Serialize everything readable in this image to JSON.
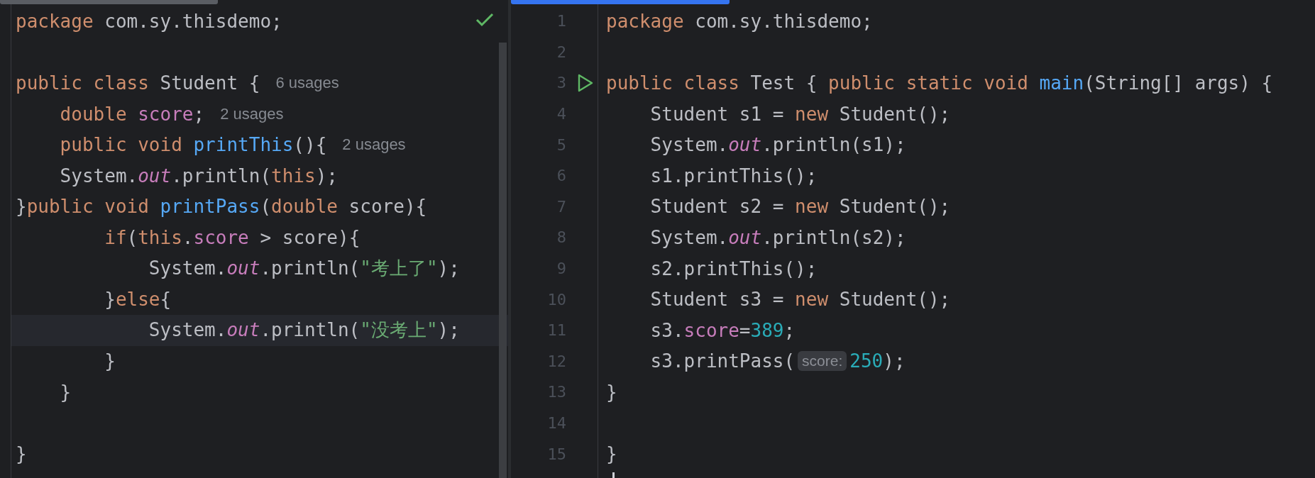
{
  "editors": [
    {
      "inspection_ok": true,
      "lines": [
        {
          "current": false,
          "tokens": [
            {
              "kind": "keyword",
              "text": "package"
            },
            {
              "kind": "plain",
              "text": " com.sy.thisdemo;"
            }
          ]
        },
        {
          "current": false
        },
        {
          "current": false,
          "usages": "6 usages",
          "tokens": [
            {
              "kind": "keyword",
              "text": "public class"
            },
            {
              "kind": "plain",
              "text": " Student {"
            }
          ]
        },
        {
          "current": false,
          "usages": "2 usages",
          "tokens": [
            {
              "kind": "keyword",
              "text": "    double"
            },
            {
              "kind": "field",
              "text": " score"
            },
            {
              "kind": "plain",
              "text": ";"
            }
          ]
        },
        {
          "current": false,
          "usages": "2 usages",
          "tokens": [
            {
              "kind": "keyword",
              "text": "    public void"
            },
            {
              "kind": "method",
              "text": " printThis"
            },
            {
              "kind": "plain",
              "text": "(){"
            }
          ]
        },
        {
          "current": false,
          "tokens": [
            {
              "kind": "plain",
              "text": "    System."
            },
            {
              "kind": "static_field",
              "text": "out"
            },
            {
              "kind": "plain",
              "text": ".println("
            },
            {
              "kind": "keyword",
              "text": "this"
            },
            {
              "kind": "plain",
              "text": ");"
            }
          ]
        },
        {
          "current": false,
          "tokens": [
            {
              "kind": "plain",
              "text": "}"
            },
            {
              "kind": "keyword",
              "text": "public void"
            },
            {
              "kind": "method",
              "text": " printPass"
            },
            {
              "kind": "plain",
              "text": "("
            },
            {
              "kind": "keyword",
              "text": "double"
            },
            {
              "kind": "plain",
              "text": " score){"
            }
          ]
        },
        {
          "current": false,
          "tokens": [
            {
              "kind": "keyword",
              "text": "        if"
            },
            {
              "kind": "plain",
              "text": "("
            },
            {
              "kind": "keyword",
              "text": "this"
            },
            {
              "kind": "plain",
              "text": "."
            },
            {
              "kind": "field",
              "text": "score"
            },
            {
              "kind": "plain",
              "text": " > score){"
            }
          ]
        },
        {
          "current": false,
          "tokens": [
            {
              "kind": "plain",
              "text": "            System."
            },
            {
              "kind": "static_field",
              "text": "out"
            },
            {
              "kind": "plain",
              "text": ".println("
            },
            {
              "kind": "string",
              "text": "\"考上了\""
            },
            {
              "kind": "plain",
              "text": ");"
            }
          ]
        },
        {
          "current": false,
          "tokens": [
            {
              "kind": "plain",
              "text": "        }"
            },
            {
              "kind": "keyword",
              "text": "else"
            },
            {
              "kind": "plain",
              "text": "{"
            }
          ]
        },
        {
          "current": true,
          "tokens": [
            {
              "kind": "plain",
              "text": "            System."
            },
            {
              "kind": "static_field",
              "text": "out"
            },
            {
              "kind": "plain",
              "text": ".println("
            },
            {
              "kind": "string",
              "text": "\"没考上\""
            },
            {
              "kind": "plain",
              "text": ");"
            }
          ]
        },
        {
          "current": false,
          "tokens": [
            {
              "kind": "plain",
              "text": "        }"
            }
          ]
        },
        {
          "current": false,
          "tokens": [
            {
              "kind": "plain",
              "text": "    }"
            }
          ]
        },
        {
          "current": false
        },
        {
          "current": false,
          "tokens": [
            {
              "kind": "plain",
              "text": "}"
            }
          ]
        }
      ]
    },
    {
      "lines": [
        {
          "number": "1",
          "current": false,
          "tokens": [
            {
              "kind": "keyword",
              "text": "package"
            },
            {
              "kind": "plain",
              "text": " com.sy.thisdemo;"
            }
          ]
        },
        {
          "number": "2",
          "current": false
        },
        {
          "number": "3",
          "current": false,
          "run_icon": true,
          "tokens": [
            {
              "kind": "keyword",
              "text": "public class"
            },
            {
              "kind": "plain",
              "text": " Test { "
            },
            {
              "kind": "keyword",
              "text": "public static void"
            },
            {
              "kind": "method",
              "text": " main"
            },
            {
              "kind": "plain",
              "text": "(String[] args) {"
            }
          ]
        },
        {
          "number": "4",
          "current": false,
          "tokens": [
            {
              "kind": "plain",
              "text": "    Student s1 = "
            },
            {
              "kind": "keyword",
              "text": "new"
            },
            {
              "kind": "plain",
              "text": " Student();"
            }
          ]
        },
        {
          "number": "5",
          "current": false,
          "tokens": [
            {
              "kind": "plain",
              "text": "    System."
            },
            {
              "kind": "static_field",
              "text": "out"
            },
            {
              "kind": "plain",
              "text": ".println(s1);"
            }
          ]
        },
        {
          "number": "6",
          "current": false,
          "tokens": [
            {
              "kind": "plain",
              "text": "    s1.printThis();"
            }
          ]
        },
        {
          "number": "7",
          "current": false,
          "tokens": [
            {
              "kind": "plain",
              "text": "    Student s2 = "
            },
            {
              "kind": "keyword",
              "text": "new"
            },
            {
              "kind": "plain",
              "text": " Student();"
            }
          ]
        },
        {
          "number": "8",
          "current": false,
          "tokens": [
            {
              "kind": "plain",
              "text": "    System."
            },
            {
              "kind": "static_field",
              "text": "out"
            },
            {
              "kind": "plain",
              "text": ".println(s2);"
            }
          ]
        },
        {
          "number": "9",
          "current": false,
          "tokens": [
            {
              "kind": "plain",
              "text": "    s2.printThis();"
            }
          ]
        },
        {
          "number": "10",
          "current": false,
          "tokens": [
            {
              "kind": "plain",
              "text": "    Student s3 = "
            },
            {
              "kind": "keyword",
              "text": "new"
            },
            {
              "kind": "plain",
              "text": " Student();"
            }
          ]
        },
        {
          "number": "11",
          "current": false,
          "tokens": [
            {
              "kind": "plain",
              "text": "    s3."
            },
            {
              "kind": "field",
              "text": "score"
            },
            {
              "kind": "plain",
              "text": "="
            },
            {
              "kind": "number",
              "text": "389"
            },
            {
              "kind": "plain",
              "text": ";"
            }
          ]
        },
        {
          "number": "12",
          "current": false,
          "tokens": [
            {
              "kind": "plain",
              "text": "    s3.printPass("
            },
            {
              "kind": "hint",
              "text": "score:"
            },
            {
              "kind": "number",
              "text": "250"
            },
            {
              "kind": "plain",
              "text": ");"
            }
          ]
        },
        {
          "number": "13",
          "current": false,
          "tokens": [
            {
              "kind": "plain",
              "text": "}"
            }
          ]
        },
        {
          "number": "14",
          "current": false
        },
        {
          "number": "15",
          "current": false,
          "tokens": [
            {
              "kind": "plain",
              "text": "}"
            }
          ]
        }
      ]
    }
  ]
}
